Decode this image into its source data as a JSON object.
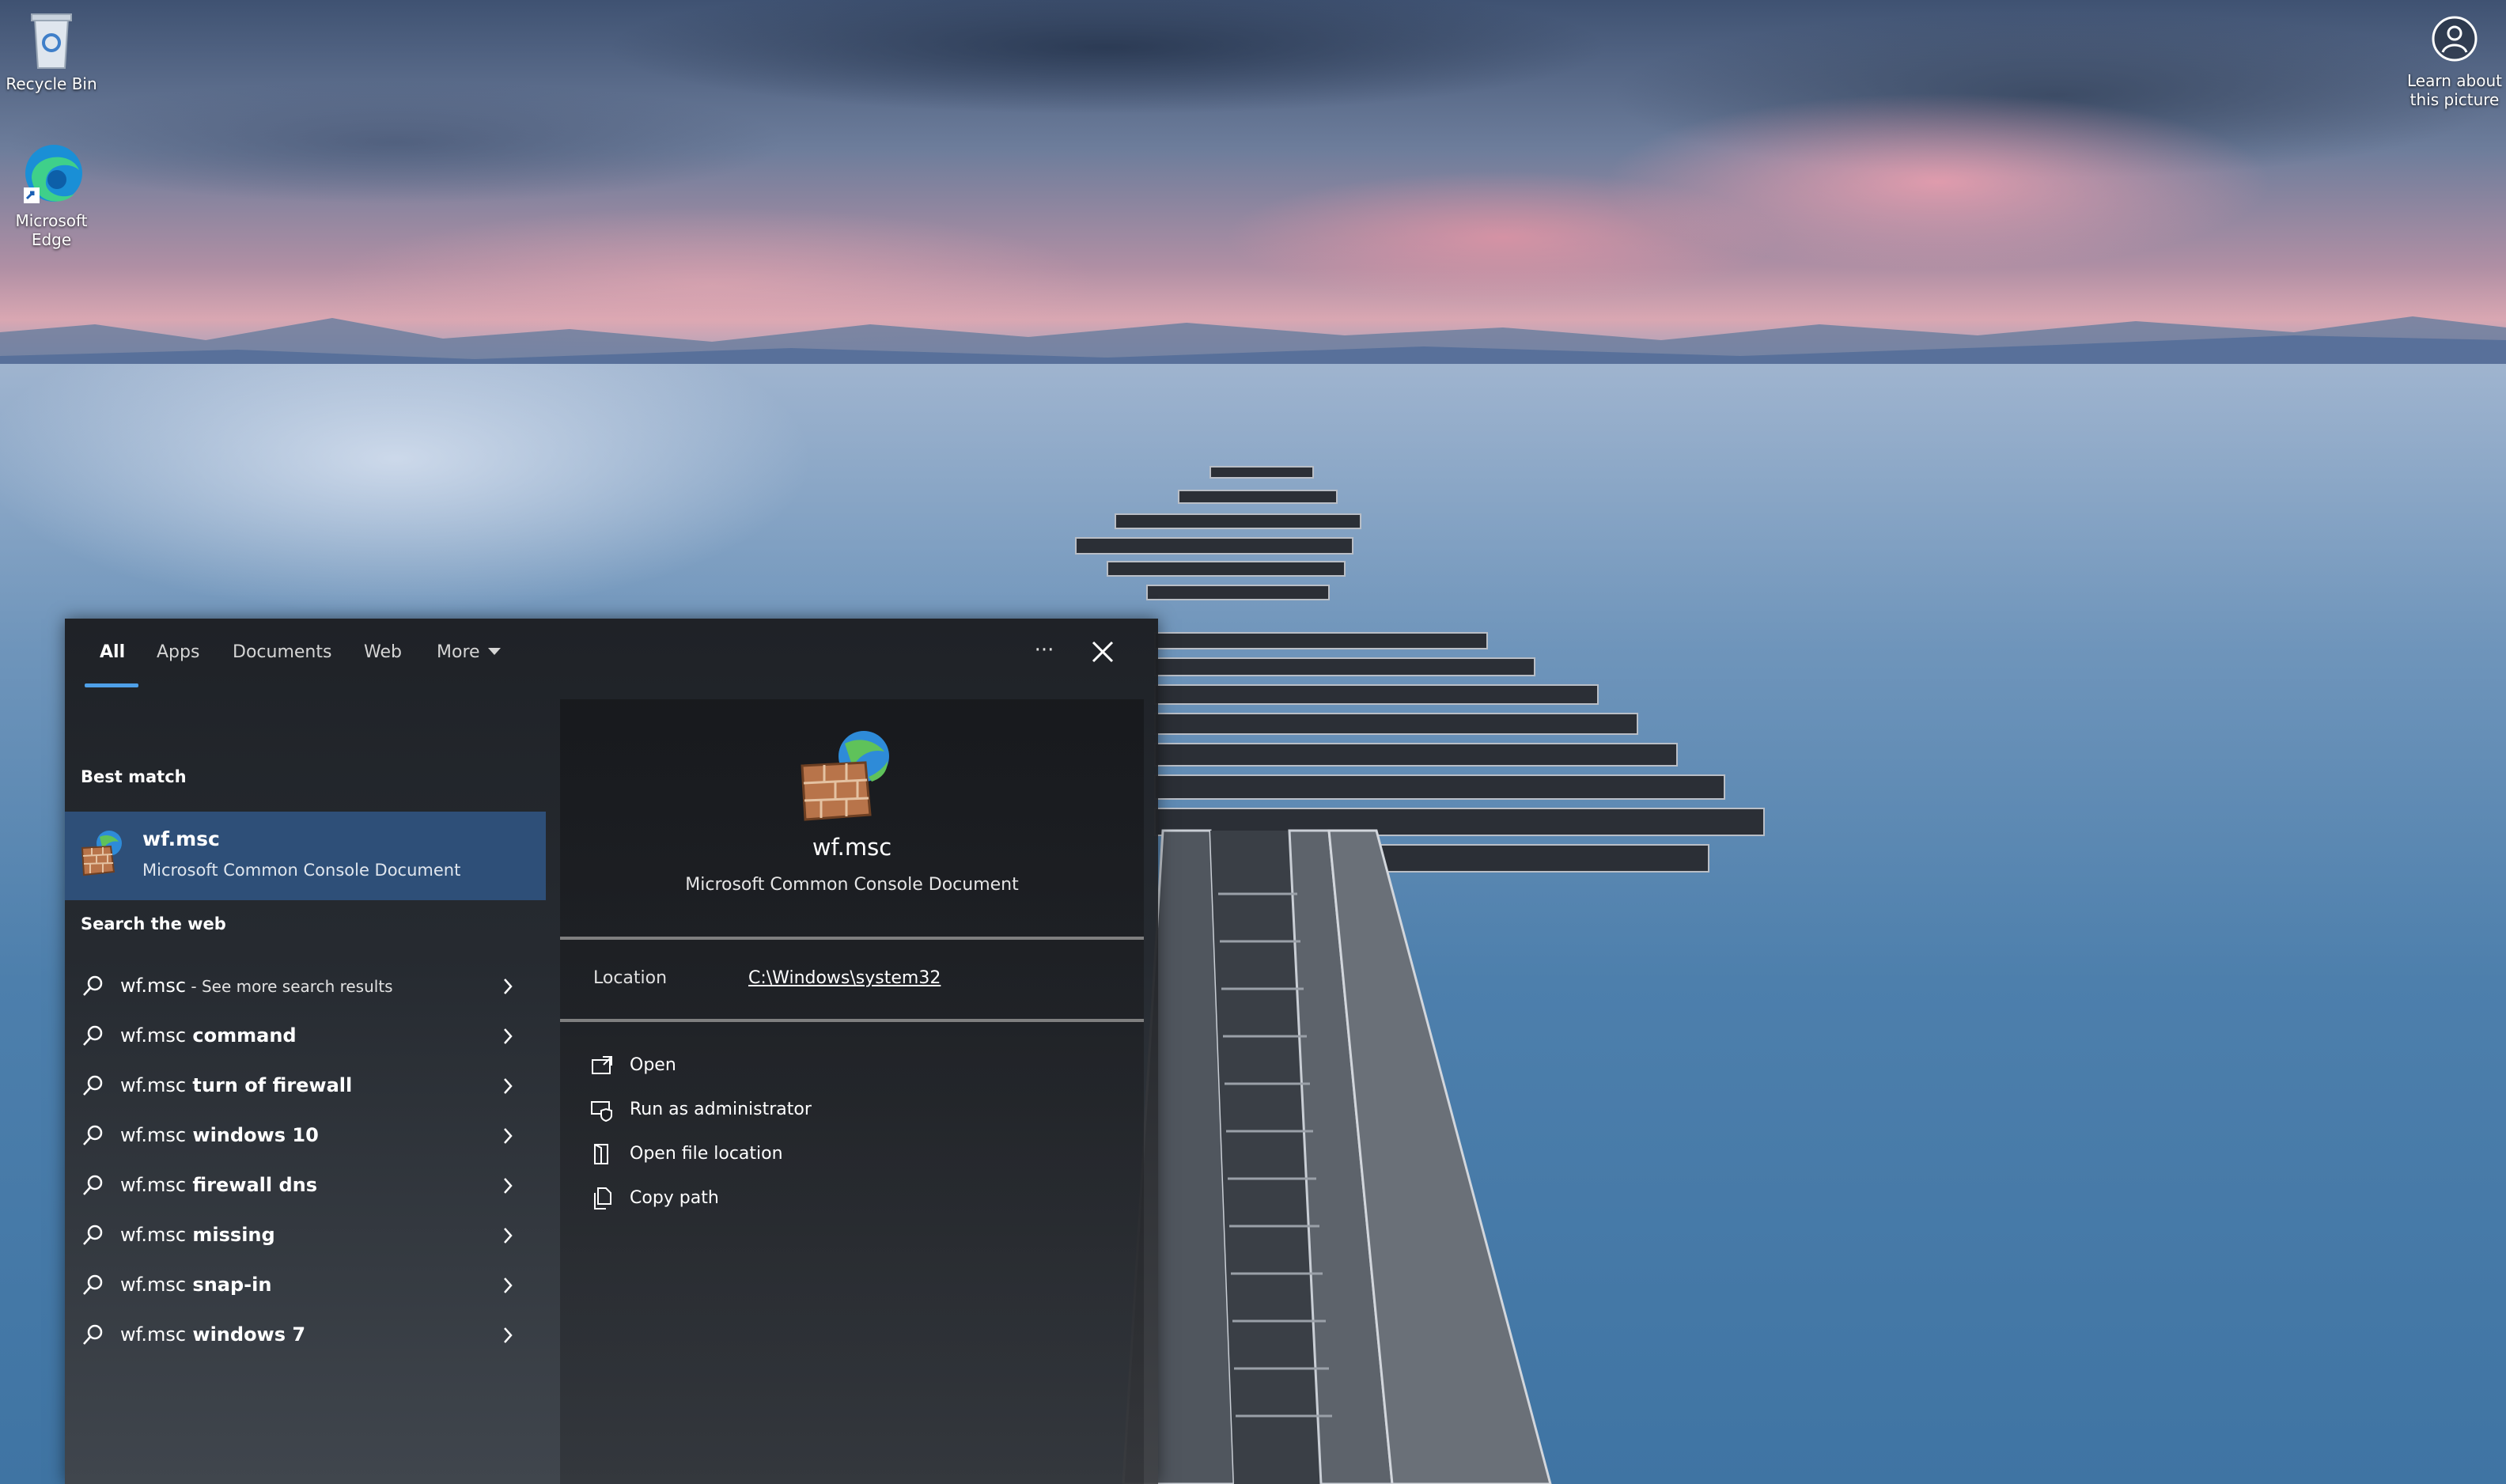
{
  "desktop": {
    "icons": [
      {
        "label": "Recycle Bin",
        "icon": "recycle-bin-icon"
      },
      {
        "label": "Microsoft Edge",
        "label_lines": [
          "Microsoft",
          "Edge"
        ],
        "icon": "edge-icon"
      }
    ],
    "learn_about": {
      "line1": "Learn about",
      "line2": "this picture",
      "icon": "camera-person-icon"
    }
  },
  "search": {
    "tabs": [
      {
        "label": "All",
        "active": true
      },
      {
        "label": "Apps"
      },
      {
        "label": "Documents"
      },
      {
        "label": "Web"
      },
      {
        "label": "More"
      }
    ],
    "best_match_heading": "Best match",
    "best_match": {
      "title": "wf.msc",
      "subtitle": "Microsoft Common Console Document",
      "icon": "firewall-globe-icon"
    },
    "web_heading": "Search the web",
    "web_results": [
      {
        "query": "wf.msc",
        "suffix": "",
        "hint": " - See more search results"
      },
      {
        "query": "wf.msc",
        "suffix": " command",
        "hint": ""
      },
      {
        "query": "wf.msc",
        "suffix": " turn of firewall",
        "hint": ""
      },
      {
        "query": "wf.msc",
        "suffix": " windows 10",
        "hint": ""
      },
      {
        "query": "wf.msc",
        "suffix": " firewall dns",
        "hint": ""
      },
      {
        "query": "wf.msc",
        "suffix": " missing",
        "hint": ""
      },
      {
        "query": "wf.msc",
        "suffix": " snap-in",
        "hint": ""
      },
      {
        "query": "wf.msc",
        "suffix": " windows 7",
        "hint": ""
      }
    ],
    "preview": {
      "title": "wf.msc",
      "subtitle": "Microsoft Common Console Document",
      "location_label": "Location",
      "location_value": "C:\\Windows\\system32",
      "actions": [
        {
          "label": "Open",
          "icon": "open-icon"
        },
        {
          "label": "Run as administrator",
          "icon": "shield-icon"
        },
        {
          "label": "Open file location",
          "icon": "file-location-icon"
        },
        {
          "label": "Copy path",
          "icon": "copy-icon"
        }
      ]
    },
    "options_glyph": "···",
    "accent": "#4ea0e8",
    "selected_bg": "#2e4f78"
  }
}
